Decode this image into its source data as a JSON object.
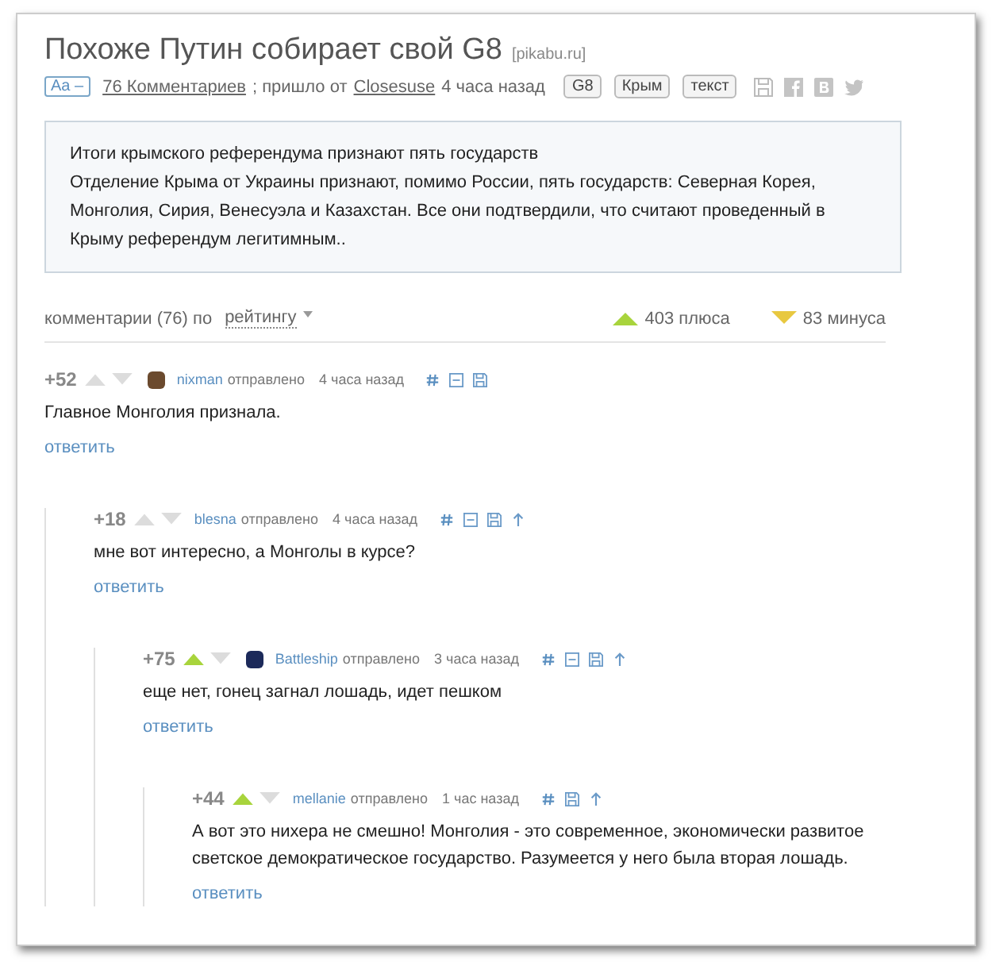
{
  "post": {
    "title": "Похоже Путин собирает свой G8",
    "source": "[pikabu.ru]",
    "font_toggle": "Aa –",
    "comments_link": "76 Комментариев",
    "came_from": "; пришло от",
    "author": "Closesuse",
    "time": "4 часа назад",
    "tags": [
      "G8",
      "Крым",
      "текст"
    ]
  },
  "quote": {
    "lines": [
      "Итоги крымского референдума признают пять государств",
      "Отделение Крыма от Украины признают, помимо России, пять государств: Северная Корея, Монголия, Сирия, Венесуэла и Казахстан. Все они подтвердили, что считают проведенный в Крыму референдум легитимным.."
    ]
  },
  "sort_bar": {
    "label": "комментарии (76) по",
    "sort": "рейтингу",
    "pluses": "403 плюса",
    "minuses": "83 минуса"
  },
  "comments": [
    {
      "rating": "+52",
      "upvoted": false,
      "author": "nixman",
      "color": "#6b4a2e",
      "sent": "отправлено",
      "time": "4 часа назад",
      "text": "Главное Монголия признала.",
      "reply": "ответить",
      "children": [
        {
          "rating": "+18",
          "upvoted": false,
          "author": "blesna",
          "sent": "отправлено",
          "time": "4 часа назад",
          "text": "мне вот интересно, а Монголы в курсе?",
          "reply": "ответить",
          "children": [
            {
              "rating": "+75",
              "upvoted": true,
              "author": "Battleship",
              "color": "#1c2a5a",
              "sent": "отправлено",
              "time": "3 часа назад",
              "text": "еще нет, гонец загнал лошадь, идет пешком",
              "reply": "ответить",
              "children": [
                {
                  "rating": "+44",
                  "upvoted": true,
                  "author": "mellanie",
                  "sent": "отправлено",
                  "time": "1 час назад",
                  "text": "А вот это нихера не смешно! Монголия - это современное, экономически развитое светское демократическое государство. Разумеется у него была вторая лошадь.",
                  "reply": "ответить"
                }
              ]
            }
          ]
        }
      ]
    }
  ]
}
